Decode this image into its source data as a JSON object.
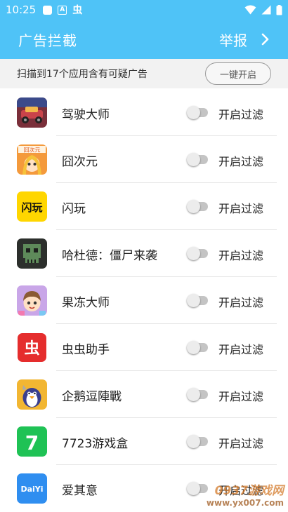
{
  "status_bar": {
    "time": "10:25",
    "icons": [
      "square-notification-icon",
      "a-box-icon",
      "chong-app-icon",
      "wifi-icon",
      "signal-icon",
      "battery-icon"
    ],
    "chong_glyph": "虫"
  },
  "header": {
    "title": "广告拦截",
    "report_label": "举报",
    "chevron": "❯",
    "background": "#4fc3f7"
  },
  "banner": {
    "text": "扫描到17个应用含有可疑广告",
    "one_key_label": "一键开启"
  },
  "apps": [
    {
      "name": "驾驶大师",
      "icon": "car-game-icon",
      "filter_label": "开启过滤",
      "filter_on": false
    },
    {
      "name": "囧次元",
      "icon": "anime-girl-icon",
      "filter_label": "开启过滤",
      "filter_on": false,
      "icon_text": "囧次元"
    },
    {
      "name": "闪玩",
      "icon": "shanwan-icon",
      "filter_label": "开启过滤",
      "filter_on": false,
      "icon_text": "闪玩"
    },
    {
      "name": "哈杜德：僵尸来袭",
      "icon": "zombie-skull-icon",
      "filter_label": "开启过滤",
      "filter_on": false
    },
    {
      "name": "果冻大师",
      "icon": "jelly-kid-icon",
      "filter_label": "开启过滤",
      "filter_on": false
    },
    {
      "name": "虫虫助手",
      "icon": "chongchong-icon",
      "filter_label": "开启过滤",
      "filter_on": false,
      "icon_text": "虫"
    },
    {
      "name": "企鹅逗陣戰",
      "icon": "penguin-icon",
      "filter_label": "开启过滤",
      "filter_on": false
    },
    {
      "name": "7723游戏盒",
      "icon": "7723-icon",
      "filter_label": "开启过滤",
      "filter_on": false,
      "icon_text": "7"
    },
    {
      "name": "爱其意",
      "icon": "aiyi-icon",
      "filter_label": "开启过滤",
      "filter_on": false,
      "icon_text": "DaiYi"
    }
  ],
  "watermark": {
    "text": "0937游戏网",
    "url": "www.yx007.com"
  }
}
